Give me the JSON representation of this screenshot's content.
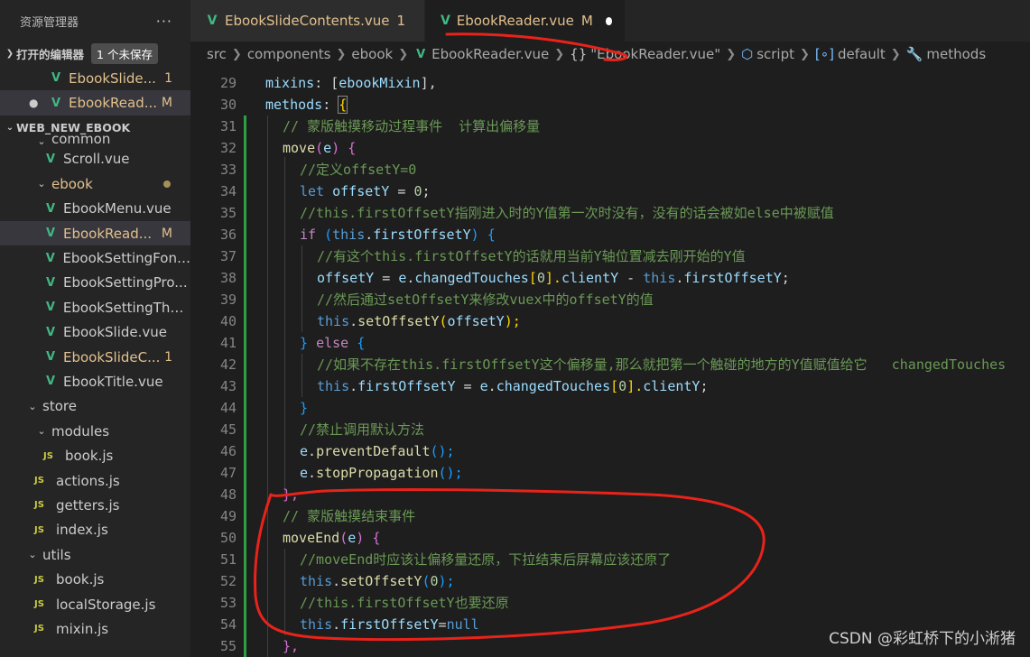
{
  "sidebar": {
    "title": "资源管理器",
    "more": "···",
    "open_editors": {
      "label": "打开的编辑器",
      "badge": "1 个未保存"
    },
    "open_files": [
      {
        "name": "EbookSlide...",
        "status": "1"
      },
      {
        "name": "EbookRead...",
        "status": "M",
        "unsaved": "●"
      }
    ],
    "project": {
      "label": "WEB_NEW_EBOOK"
    },
    "tree": [
      {
        "name": "common",
        "kind": "folder"
      },
      {
        "name": "Scroll.vue",
        "kind": "vue"
      },
      {
        "name": "ebook",
        "kind": "folder"
      },
      {
        "name": "EbookMenu.vue",
        "kind": "vue"
      },
      {
        "name": "EbookRead...",
        "kind": "vue",
        "status": "M"
      },
      {
        "name": "EbookSettingFont...",
        "kind": "vue"
      },
      {
        "name": "EbookSettingPro...",
        "kind": "vue"
      },
      {
        "name": "EbookSettingThe...",
        "kind": "vue"
      },
      {
        "name": "EbookSlide.vue",
        "kind": "vue"
      },
      {
        "name": "EbookSlideC...",
        "kind": "vue",
        "status": "1"
      },
      {
        "name": "EbookTitle.vue",
        "kind": "vue"
      },
      {
        "name": "store",
        "kind": "folder"
      },
      {
        "name": "modules",
        "kind": "folder"
      },
      {
        "name": "book.js",
        "kind": "js"
      },
      {
        "name": "actions.js",
        "kind": "js"
      },
      {
        "name": "getters.js",
        "kind": "js"
      },
      {
        "name": "index.js",
        "kind": "js"
      },
      {
        "name": "utils",
        "kind": "folder"
      },
      {
        "name": "book.js",
        "kind": "js"
      },
      {
        "name": "localStorage.js",
        "kind": "js"
      },
      {
        "name": "mixin.js",
        "kind": "js"
      }
    ]
  },
  "tabs": [
    {
      "label": "EbookSlideContents.vue",
      "mark": "1"
    },
    {
      "label": "EbookReader.vue",
      "mark": "M"
    }
  ],
  "breadcrumbs": [
    "src",
    "components",
    "ebook",
    "EbookReader.vue",
    "\"EbookReader.vue\"",
    "script",
    "default",
    "methods"
  ],
  "code_lines": [
    "29",
    "30",
    "31",
    "32",
    "33",
    "34",
    "35",
    "36",
    "37",
    "38",
    "39",
    "40",
    "41",
    "42",
    "43",
    "44",
    "45",
    "46",
    "47",
    "48",
    "49",
    "50",
    "51",
    "52",
    "53",
    "54",
    "55"
  ],
  "code": {
    "l29": [
      "mixins",
      ": [",
      "ebookMixin",
      "],"
    ],
    "l30": [
      "methods",
      ": ",
      "{"
    ],
    "l31": "// 蒙版触摸移动过程事件  计算出偏移量",
    "l32": [
      "move",
      "(",
      "e",
      ") ",
      "{"
    ],
    "l33": "//定义offsetY=0",
    "l34": [
      "let ",
      "offsetY",
      " = ",
      "0",
      ";"
    ],
    "l35": "//this.firstOffsetY指刚进入时的Y值第一次时没有，没有的话会被如else中被赋值",
    "l36": [
      "if ",
      "(",
      "this",
      ".",
      "firstOffsetY",
      ") ",
      "{"
    ],
    "l37": "//有这个this.firstOffsetY的话就用当前Y轴位置减去刚开始的Y值",
    "l38": [
      "offsetY",
      " = ",
      "e",
      ".",
      "changedTouches",
      "[",
      "0",
      "].",
      "clientY",
      " - ",
      "this",
      ".",
      "firstOffsetY",
      ";"
    ],
    "l39": "//然后通过setOffsetY来修改vuex中的offsetY的值",
    "l40": [
      "this",
      ".",
      "setOffsetY",
      "(",
      "offsetY",
      ");"
    ],
    "l41": [
      "} ",
      "else ",
      "{"
    ],
    "l42": "//如果不存在this.firstOffsetY这个偏移量,那么就把第一个触碰的地方的Y值赋值给它   changedTouches",
    "l43": [
      "this",
      ".",
      "firstOffsetY",
      " = ",
      "e",
      ".",
      "changedTouches",
      "[",
      "0",
      "].",
      "clientY",
      ";"
    ],
    "l44": "}",
    "l45": "//禁止调用默认方法",
    "l46": [
      "e",
      ".",
      "preventDefault",
      "();"
    ],
    "l47": [
      "e",
      ".",
      "stopPropagation",
      "();"
    ],
    "l48": "},",
    "l49": "// 蒙版触摸结束事件",
    "l50": [
      "moveEnd",
      "(",
      "e",
      ") ",
      "{"
    ],
    "l51": "//moveEnd时应该让偏移量还原，下拉结束后屏幕应该还原了",
    "l52": [
      "this",
      ".",
      "setOffsetY",
      "(",
      "0",
      ");"
    ],
    "l53": "//this.firstOffsetY也要还原",
    "l54": [
      "this",
      ".",
      "firstOffsetY",
      "=",
      "null"
    ],
    "l55": "},"
  },
  "watermark": "CSDN @彩虹桥下的小淅猪",
  "colors": {
    "annotation": "#e8231a",
    "modified": "#e2c08d",
    "vue": "#41b883",
    "js": "#cbcb41"
  }
}
